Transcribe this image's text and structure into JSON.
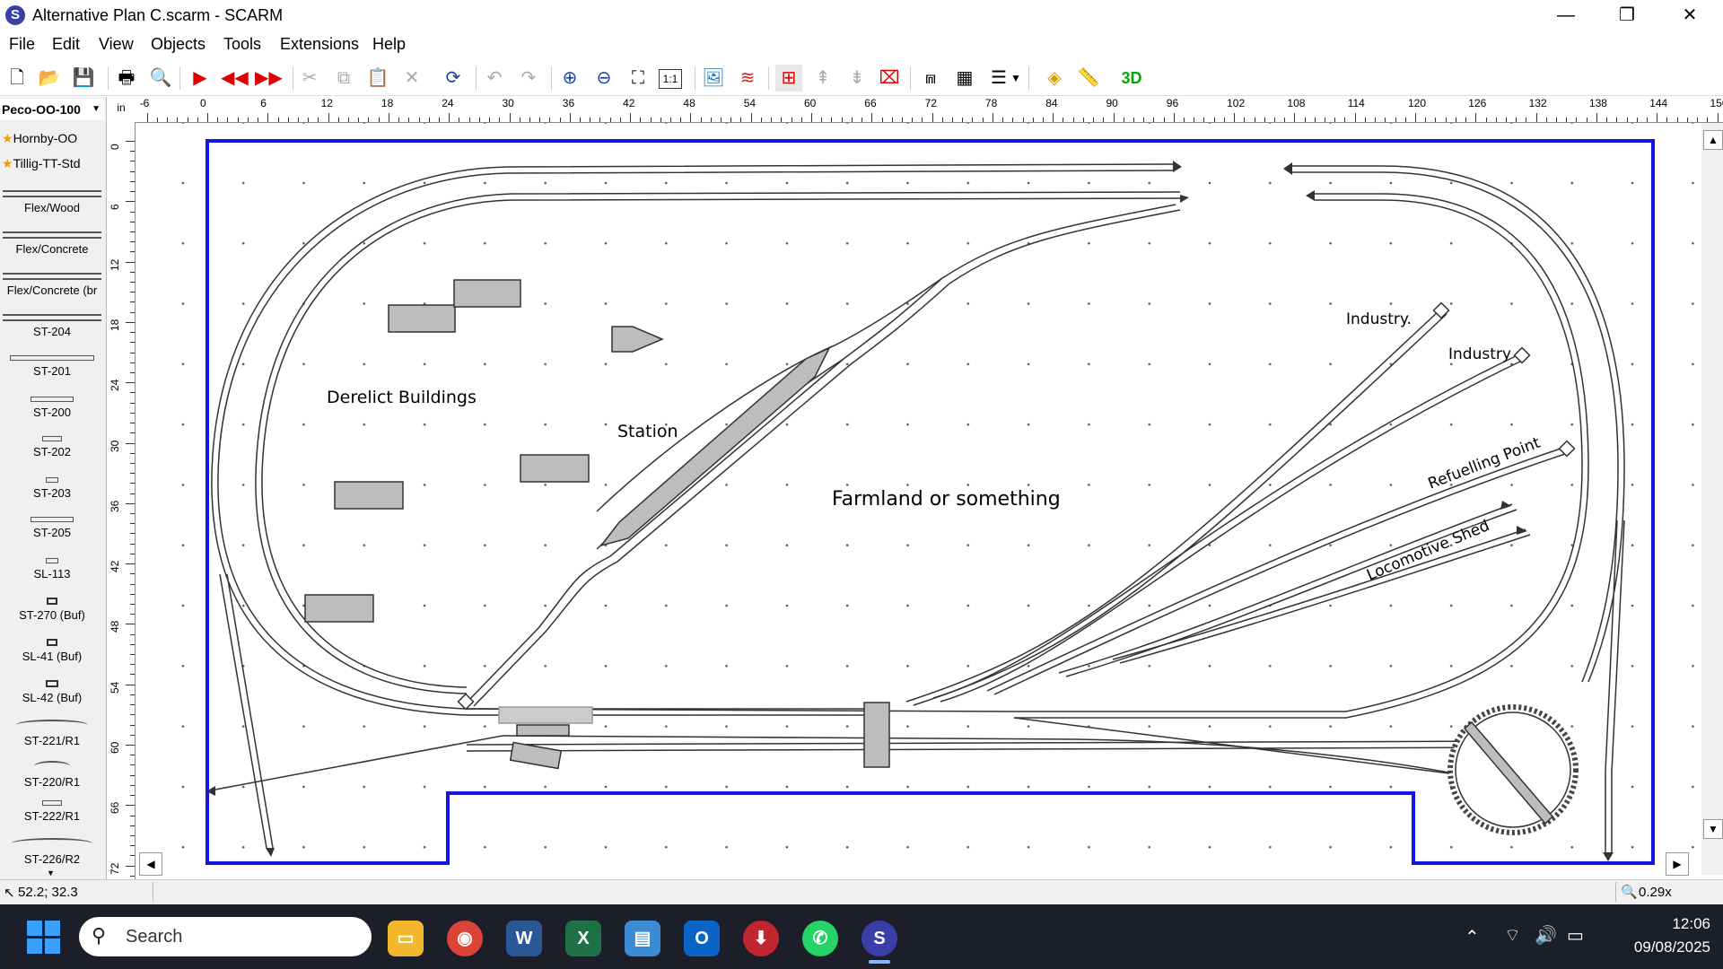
{
  "window": {
    "title": "Alternative Plan C.scarm - SCARM",
    "app_icon_letter": "S",
    "minimize": "—",
    "maximize": "❐",
    "close": "✕"
  },
  "menu": [
    "File",
    "Edit",
    "View",
    "Objects",
    "Tools",
    "Extensions",
    "Help"
  ],
  "toolbar": {
    "buttons": [
      "new-icon",
      "open-icon",
      "save-icon",
      "print-icon",
      "print-preview-icon",
      "play-icon",
      "rewind-icon",
      "forward-icon",
      "cut-icon",
      "copy-icon",
      "paste-icon",
      "delete-icon",
      "refresh-icon",
      "undo-icon",
      "redo-icon",
      "zoom-in-icon",
      "zoom-out-icon",
      "fit-icon",
      "actual-size-icon",
      "background-icon",
      "layers-icon",
      "track-tool-icon",
      "height-up-icon",
      "height-down-icon",
      "split-icon",
      "bridge-icon",
      "tunnel-icon",
      "track-list-icon",
      "dropdown-icon",
      "measure-icon",
      "ruler-icon",
      "3d-icon"
    ],
    "label_3d": "3D",
    "label_11": "1:1"
  },
  "library": {
    "selected": "Peco-OO-100",
    "favorites": [
      "Hornby-OO",
      "Tillig-TT-Std"
    ],
    "tracks": [
      "Flex/Wood",
      "Flex/Concrete",
      "Flex/Concrete (br",
      "ST-204",
      "ST-201",
      "ST-200",
      "ST-202",
      "ST-203",
      "ST-205",
      "SL-113",
      "ST-270 (Buf)",
      "SL-41 (Buf)",
      "SL-42 (Buf)",
      "ST-221/R1",
      "ST-220/R1",
      "ST-222/R1",
      "ST-226/R2"
    ]
  },
  "ruler": {
    "unit": "in",
    "h_labels": [
      "-6",
      "0",
      "6",
      "12",
      "18",
      "24",
      "30",
      "36",
      "42",
      "48",
      "54",
      "60",
      "66",
      "72",
      "78",
      "84",
      "90",
      "96",
      "102",
      "108",
      "114",
      "120",
      "126",
      "132",
      "138",
      "144",
      "150"
    ],
    "v_labels": [
      "0",
      "6",
      "12",
      "18",
      "24",
      "30",
      "36",
      "42",
      "48",
      "54",
      "60",
      "66",
      "72"
    ]
  },
  "canvas_labels": {
    "derelict": "Derelict Buildings",
    "station": "Station",
    "farmland": "Farmland or something",
    "industry1": "Industry.",
    "industry2": "Industry",
    "refuelling": "Refuelling Point",
    "loco_shed": "Locomotive Shed"
  },
  "colors": {
    "baseboard": "#1515e0",
    "track": "#333333",
    "object_fill": "#bdbdbd",
    "taskbar": "#1c1f2a"
  },
  "status": {
    "coords": "52.2; 32.3",
    "zoom": "0.29x"
  },
  "taskbar": {
    "search_placeholder": "Search",
    "time": "12:06",
    "date": "09/08/2025",
    "apps": [
      "file-explorer-icon",
      "chrome-icon",
      "word-icon",
      "excel-icon",
      "files-icon",
      "outlook-icon",
      "download-icon",
      "whatsapp-icon",
      "scarm-icon"
    ]
  }
}
